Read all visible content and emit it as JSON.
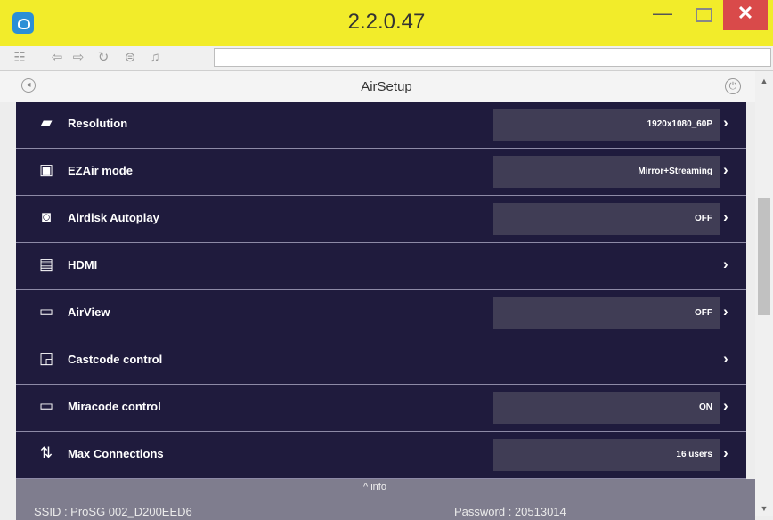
{
  "window": {
    "title": "2.2.0.47",
    "minimize": "—",
    "close": "✕"
  },
  "toolbar": {
    "icons": [
      "apps-grid-icon",
      "back-icon",
      "forward-icon",
      "refresh-icon",
      "home-icon",
      "music-icon"
    ],
    "url": ""
  },
  "page": {
    "title": "AirSetup"
  },
  "settings": [
    {
      "icon": "resolution-icon",
      "label": "Resolution",
      "value": "1920x1080_60P"
    },
    {
      "icon": "ezair-mode-icon",
      "label": "EZAir mode",
      "value": "Mirror+Streaming"
    },
    {
      "icon": "airdisk-icon",
      "label": "Airdisk Autoplay",
      "value": "OFF"
    },
    {
      "icon": "hdmi-icon",
      "label": "HDMI",
      "value": ""
    },
    {
      "icon": "airview-icon",
      "label": "AirView",
      "value": "OFF"
    },
    {
      "icon": "castcode-icon",
      "label": "Castcode control",
      "value": ""
    },
    {
      "icon": "miracode-icon",
      "label": "Miracode control",
      "value": "ON"
    },
    {
      "icon": "connections-icon",
      "label": "Max Connections",
      "value": "16 users"
    }
  ],
  "footer": {
    "info_label": "^ info",
    "ssid": "SSID : ProSG 002_D200EED6",
    "password": "Password : 20513014"
  }
}
